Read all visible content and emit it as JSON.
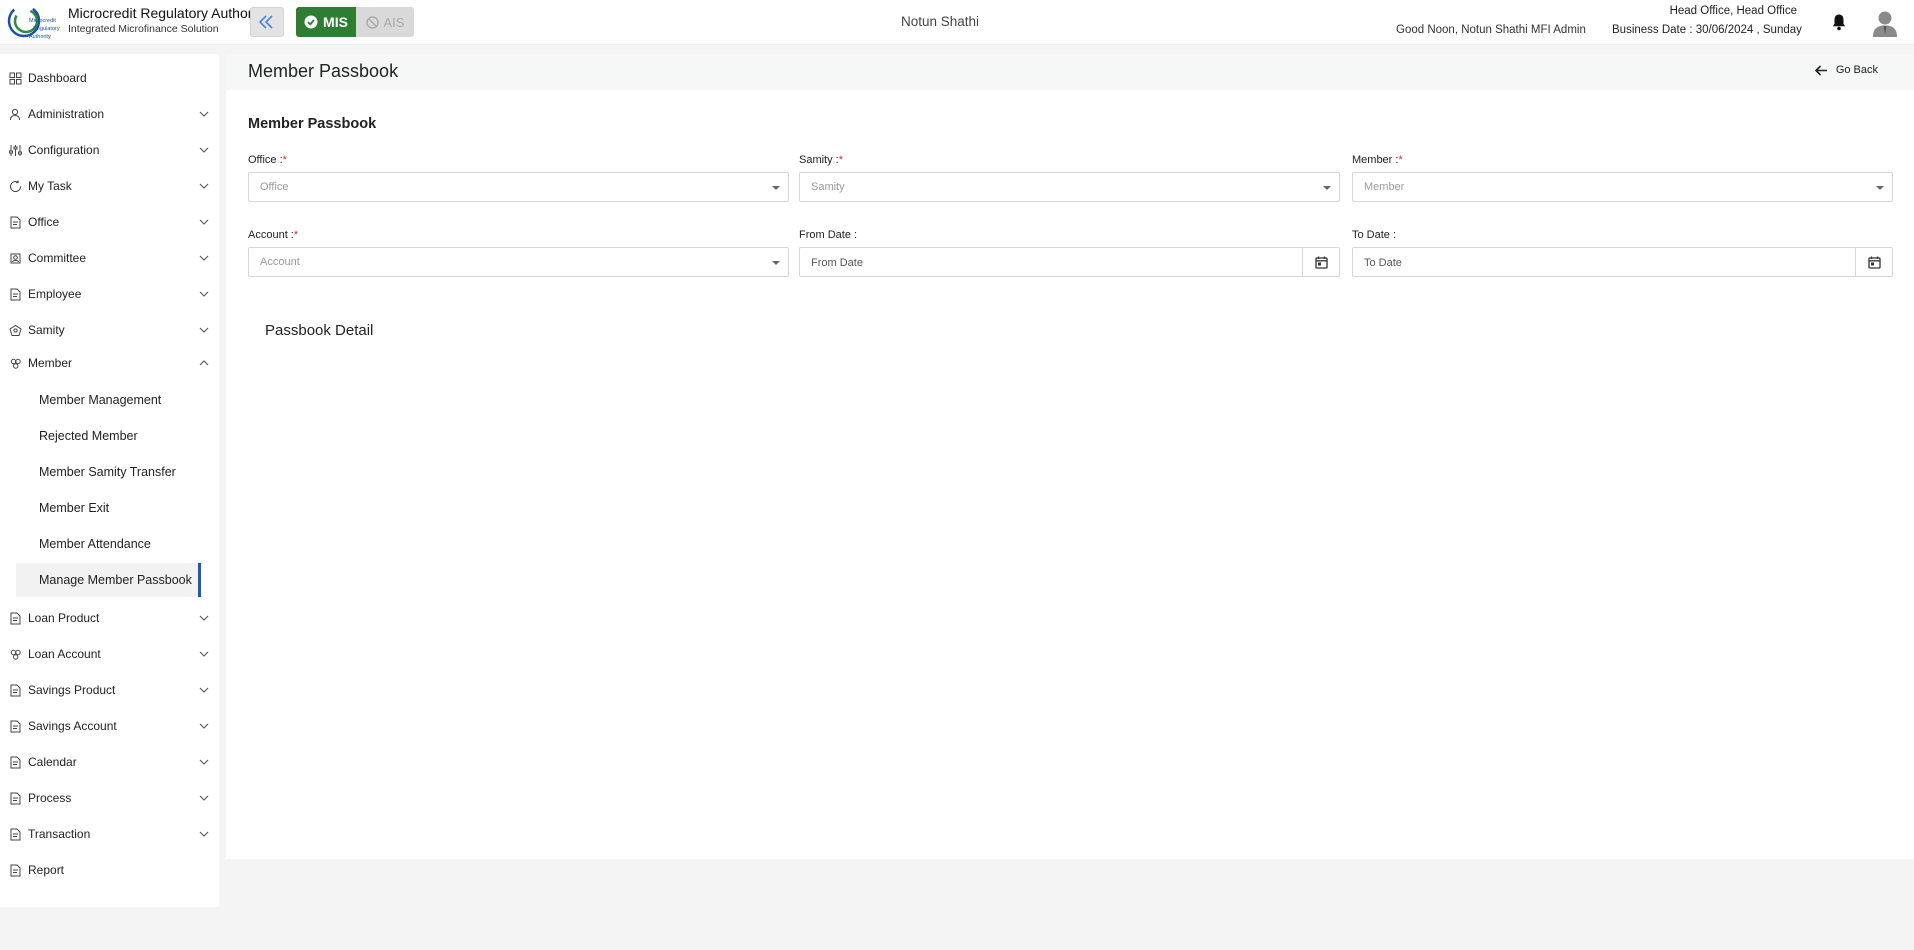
{
  "header": {
    "brand_title": "Microcredit Regulatory Authority",
    "brand_subtitle": "Integrated Microfinance Solution",
    "logo_text": "Microcredit Regulatory Authority",
    "modes": {
      "mis": "MIS",
      "ais": "AIS"
    },
    "org_name": "Notun Shathi",
    "greeting": "Good Noon, Notun Shathi MFI Admin",
    "office": "Head Office, Head Office",
    "business_date": "Business Date : 30/06/2024 , Sunday",
    "icons": {
      "collapse": "double-chevron-left-icon",
      "bell": "bell-icon",
      "avatar": "user-avatar-icon"
    }
  },
  "sidebar": {
    "items": [
      {
        "label": "Dashboard",
        "icon": "grid-icon"
      },
      {
        "label": "Administration",
        "icon": "admin-icon"
      },
      {
        "label": "Configuration",
        "icon": "sliders-icon"
      },
      {
        "label": "My Task",
        "icon": "task-cycle-icon"
      },
      {
        "label": "Office",
        "icon": "document-icon"
      },
      {
        "label": "Committee",
        "icon": "committee-icon"
      },
      {
        "label": "Employee",
        "icon": "document-icon"
      },
      {
        "label": "Samity",
        "icon": "samity-icon"
      },
      {
        "label": "Member",
        "icon": "members-icon"
      },
      {
        "label": "Loan Product",
        "icon": "document-icon"
      },
      {
        "label": "Loan Account",
        "icon": "members-icon"
      },
      {
        "label": "Savings Product",
        "icon": "document-icon"
      },
      {
        "label": "Savings Account",
        "icon": "document-icon"
      },
      {
        "label": "Calendar",
        "icon": "document-icon"
      },
      {
        "label": "Process",
        "icon": "document-icon"
      },
      {
        "label": "Transaction",
        "icon": "document-icon"
      },
      {
        "label": "Report",
        "icon": "document-icon"
      }
    ],
    "member_sub": [
      {
        "label": "Member Management"
      },
      {
        "label": "Rejected Member"
      },
      {
        "label": "Member Samity Transfer"
      },
      {
        "label": "Member Exit"
      },
      {
        "label": "Member Attendance"
      },
      {
        "label": "Manage Member Passbook"
      }
    ]
  },
  "main": {
    "page_title": "Member Passbook",
    "go_back": "Go Back",
    "section_title": "Member Passbook",
    "required_mark": "*",
    "fields": {
      "office": {
        "label": "Office :",
        "placeholder": "Office"
      },
      "samity": {
        "label": "Samity :",
        "placeholder": "Samity"
      },
      "member": {
        "label": "Member :",
        "placeholder": "Member"
      },
      "account": {
        "label": "Account :",
        "placeholder": "Account"
      },
      "from_date": {
        "label": "From Date :",
        "placeholder": "From Date"
      },
      "to_date": {
        "label": "To Date :",
        "placeholder": "To Date"
      }
    },
    "passbook_detail": "Passbook Detail"
  },
  "colors": {
    "mis_active": "#2e7d32",
    "active_indicator": "#1e5bb8",
    "required": "#d32f2f"
  }
}
